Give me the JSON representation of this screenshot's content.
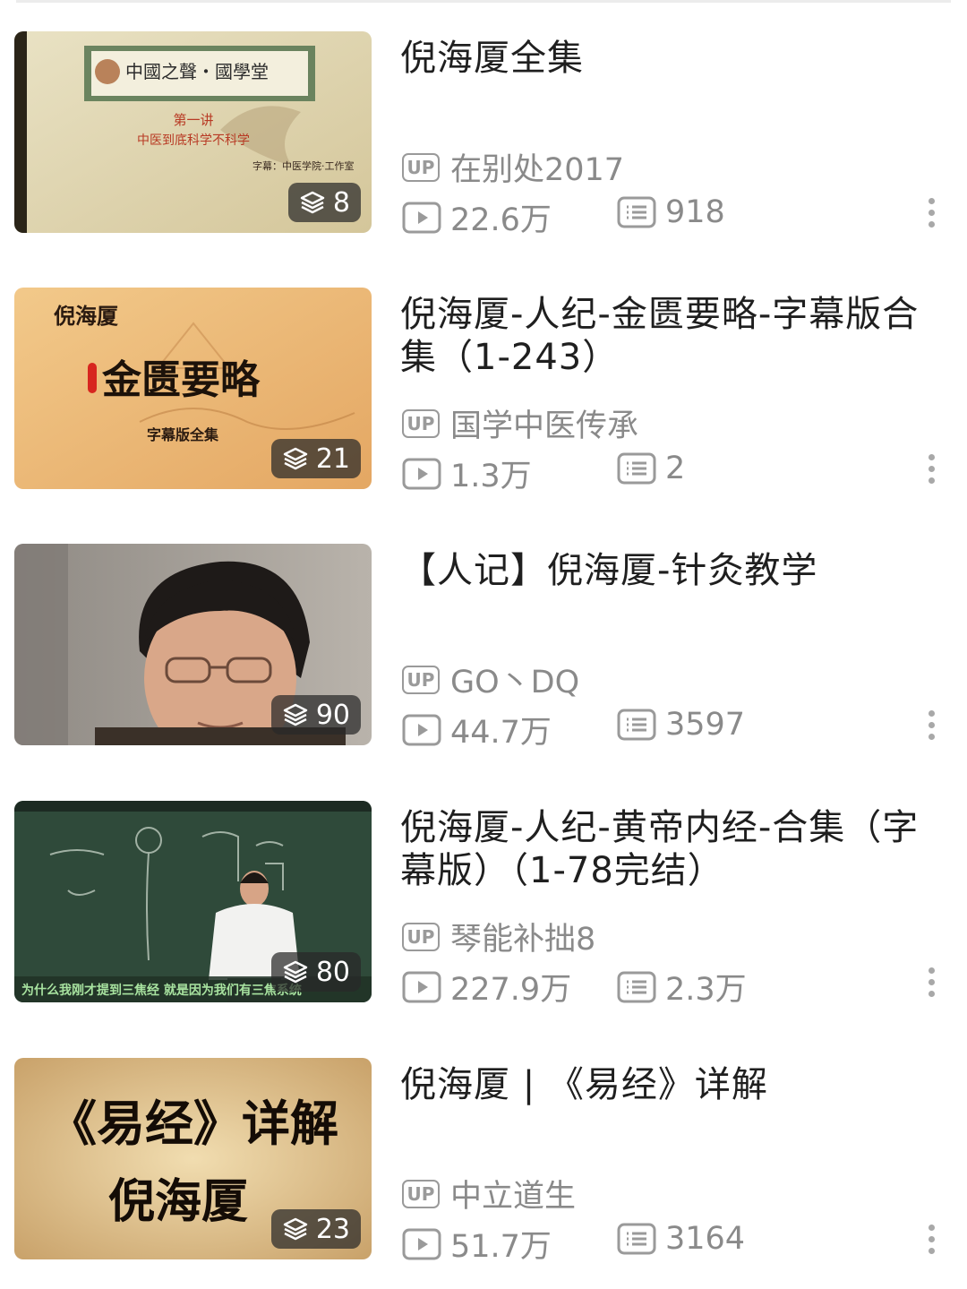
{
  "items": [
    {
      "title": "倪海厦全集",
      "uploader": "在别处2017",
      "plays": "22.6万",
      "comments": "918",
      "episode_count": "8",
      "thumbnail": {
        "header_text": "中國之聲・國學堂",
        "line1": "第一讲",
        "line2": "中医到底科学不科学",
        "credit": "字幕：中医学院·工作室"
      }
    },
    {
      "title": "倪海厦-人纪-金匮要略-字幕版合集（1-243）",
      "uploader": "国学中医传承",
      "plays": "1.3万",
      "comments": "2",
      "episode_count": "21",
      "thumbnail": {
        "author": "倪海厦",
        "main": "金匮要略",
        "sub": "字幕版全集"
      }
    },
    {
      "title": "【人记】倪海厦-针灸教学",
      "uploader": "GO丶DQ",
      "plays": "44.7万",
      "comments": "3597",
      "episode_count": "90"
    },
    {
      "title": "倪海厦-人纪-黄帝内经-合集（字幕版）（1-78完结）",
      "uploader": "琴能补拙8",
      "plays": "227.9万",
      "comments": "2.3万",
      "episode_count": "80",
      "thumbnail": {
        "subtitle": "为什么我刚才提到三焦经 就是因为我们有三焦系统"
      }
    },
    {
      "title": "倪海厦 | 《易经》详解",
      "uploader": "中立道生",
      "plays": "51.7万",
      "comments": "3164",
      "episode_count": "23",
      "thumbnail": {
        "main": "《易经》详解",
        "author": "倪海厦"
      }
    }
  ],
  "labels": {
    "up_tag": "UP"
  },
  "icons": {
    "episode_badge": "stack-layers-icon",
    "plays": "play-icon",
    "comments": "comment-list-icon",
    "more": "more-vertical-icon"
  },
  "colors": {
    "title": "#1f1f1f",
    "meta": "#8a8a8a",
    "badge_bg": "#282828"
  }
}
